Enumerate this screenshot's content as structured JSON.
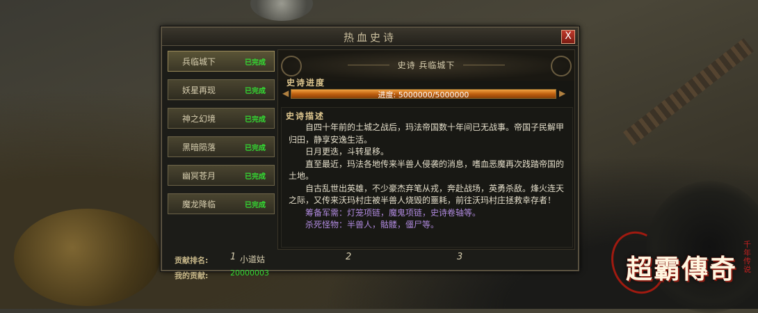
{
  "window": {
    "title": "热血史诗",
    "close_label": "X"
  },
  "sidebar": {
    "items": [
      {
        "label": "兵临城下",
        "status": "已完成"
      },
      {
        "label": "妖星再现",
        "status": "已完成"
      },
      {
        "label": "神之幻境",
        "status": "已完成"
      },
      {
        "label": "黑暗陨落",
        "status": "已完成"
      },
      {
        "label": "幽冥苍月",
        "status": "已完成"
      },
      {
        "label": "魔龙降临",
        "status": "已完成"
      }
    ]
  },
  "main": {
    "banner": "史诗  兵临城下",
    "progress": {
      "label": "史诗进度",
      "text": "进度: 5000000/5000000",
      "current": 5000000,
      "total": 5000000,
      "fraction": 1.0
    },
    "description": {
      "label": "史诗描述",
      "paragraphs": [
        "自四十年前的土城之战后，玛法帝国数十年间已无战事。帝国子民解甲归田，静享安逸生活。",
        "日月更迭，斗转星移。",
        "直至最近，玛法各地传来半兽人侵袭的消息，嗜血恶魔再次践踏帝国的土地。",
        "自古乱世出英雄，不少豪杰弃笔从戎，奔赴战场，英勇杀敌。烽火连天之际，又传来沃玛村庄被半兽人烧毁的噩耗，前往沃玛村庄拯救幸存者！",
        "筹备军需：灯笼项链，魔鬼项链，史诗卷轴等。",
        "杀死怪物：半兽人，骷髅，僵尸等。"
      ]
    }
  },
  "footer": {
    "rank_label": "贡献排名:",
    "rank1_num": "1",
    "rank1_name": "小道姑",
    "rank2_num": "2",
    "rank3_num": "3",
    "contrib_label": "我的贡献:",
    "contrib_value": "20000003"
  },
  "logo": {
    "main": "超霸傳奇",
    "sub": "千年传说"
  },
  "colors": {
    "done_green": "#33dd33",
    "purple_text": "#b08adf",
    "progress_orange": "#c06010"
  }
}
